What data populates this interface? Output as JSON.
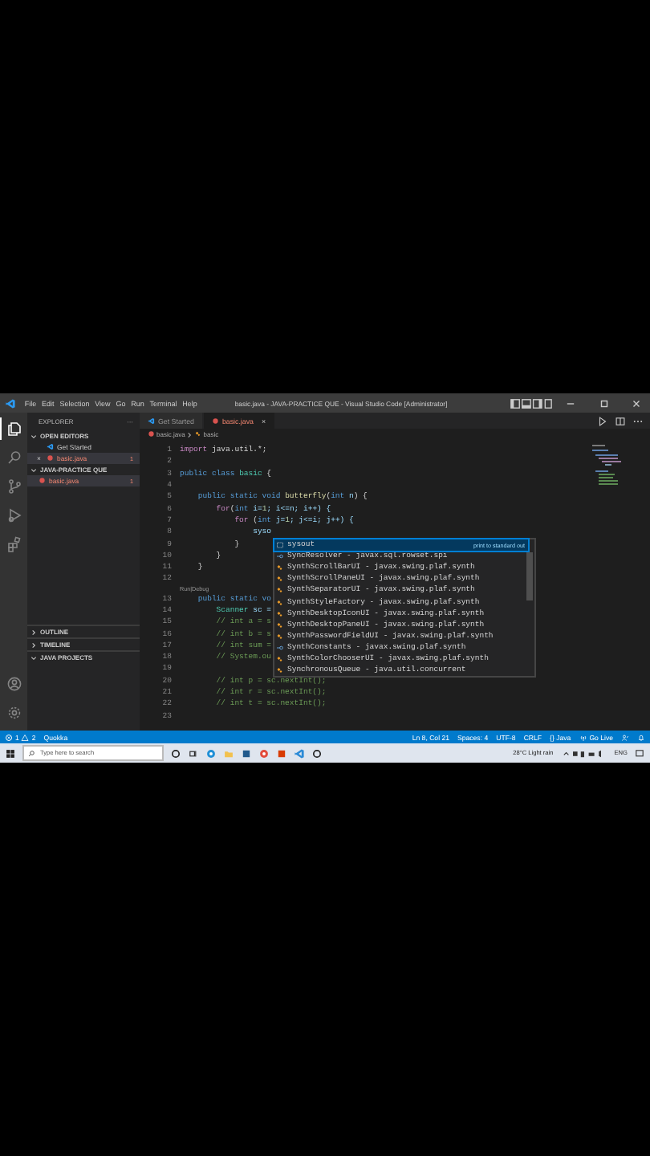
{
  "title_bar": {
    "menu": [
      "File",
      "Edit",
      "Selection",
      "View",
      "Go",
      "Run",
      "Terminal",
      "Help"
    ],
    "title": "basic.java - JAVA-PRACTICE QUE - Visual Studio Code [Administrator]"
  },
  "activity_bar": {
    "top": [
      {
        "kind": "files",
        "selected": true
      },
      {
        "kind": "search",
        "selected": false
      },
      {
        "kind": "source-control",
        "selected": false
      },
      {
        "kind": "run-debug",
        "selected": false
      },
      {
        "kind": "extensions",
        "selected": false
      }
    ],
    "bottom": [
      {
        "kind": "account"
      },
      {
        "kind": "settings"
      }
    ]
  },
  "sidebar": {
    "title": "EXPLORER",
    "more": "···",
    "sections": [
      {
        "label": "OPEN EDITORS",
        "expanded": true,
        "items": [
          {
            "label": "Get Started",
            "kind": "welcome",
            "error": false,
            "selected": false
          },
          {
            "label": "basic.java",
            "kind": "java",
            "error": true,
            "badge": "1",
            "close": "×",
            "selected": true
          }
        ]
      },
      {
        "label": "JAVA-PRACTICE QUE",
        "expanded": true,
        "items": [
          {
            "label": "basic.java",
            "kind": "java",
            "error": true,
            "badge": "1",
            "selected": true
          }
        ]
      }
    ],
    "panels": [
      {
        "label": "OUTLINE",
        "expanded": false
      },
      {
        "label": "TIMELINE",
        "expanded": false
      },
      {
        "label": "JAVA PROJECTS",
        "expanded": true
      }
    ]
  },
  "editor": {
    "tabs": [
      {
        "label": "Get Started",
        "kind": "welcome",
        "error": false,
        "selected": false
      },
      {
        "label": "basic.java",
        "kind": "java",
        "error": true,
        "close": "×",
        "selected": true
      }
    ],
    "breadcrumb": [
      {
        "label": "basic.java",
        "kind": "java"
      },
      {
        "label": "basic",
        "kind": "class"
      }
    ],
    "lines": [
      {
        "kind": "code",
        "number": "1",
        "tokens": [
          {
            "text": "import ",
            "kind": "ctl"
          },
          {
            "text": "java.util.*;",
            "kind": "txt"
          }
        ]
      },
      {
        "kind": "code",
        "number": "2"
      },
      {
        "kind": "code",
        "number": "3",
        "tokens": [
          {
            "text": "public class ",
            "kind": "kw"
          },
          {
            "text": "basic",
            "kind": "type"
          },
          {
            "text": " {",
            "kind": "txt"
          }
        ]
      },
      {
        "kind": "code",
        "number": "4"
      },
      {
        "kind": "code",
        "number": "5",
        "tokens": [
          {
            "text": "    public static void ",
            "kind": "kw"
          },
          {
            "text": "butterfly",
            "kind": "fn"
          },
          {
            "text": "(",
            "kind": "txt"
          },
          {
            "text": "int",
            "kind": "kw"
          },
          {
            "text": " n",
            "kind": "var"
          },
          {
            "text": ") {",
            "kind": "txt"
          }
        ]
      },
      {
        "kind": "code",
        "number": "6",
        "tokens": [
          {
            "text": "        for",
            "kind": "ctl"
          },
          {
            "text": "(",
            "kind": "txt"
          },
          {
            "text": "int",
            "kind": "kw"
          },
          {
            "text": " i=",
            "kind": "var"
          },
          {
            "text": "1",
            "kind": "num"
          },
          {
            "text": "; i<=n; i++) {",
            "kind": "var"
          }
        ]
      },
      {
        "kind": "code",
        "number": "7",
        "tokens": [
          {
            "text": "            for",
            "kind": "ctl"
          },
          {
            "text": " (",
            "kind": "txt"
          },
          {
            "text": "int",
            "kind": "kw"
          },
          {
            "text": " j=",
            "kind": "var"
          },
          {
            "text": "1",
            "kind": "num"
          },
          {
            "text": "; j<=i; j++) {",
            "kind": "var"
          }
        ]
      },
      {
        "kind": "code",
        "number": "8",
        "tokens": [
          {
            "text": "                syso",
            "kind": "var"
          }
        ]
      },
      {
        "kind": "code",
        "number": "9",
        "tokens": [
          {
            "text": "            }",
            "kind": "txt"
          }
        ]
      },
      {
        "kind": "code",
        "number": "10",
        "tokens": [
          {
            "text": "        }",
            "kind": "txt"
          }
        ]
      },
      {
        "kind": "code",
        "number": "11",
        "tokens": [
          {
            "text": "    }",
            "kind": "txt"
          }
        ]
      },
      {
        "kind": "code",
        "number": "12"
      },
      {
        "kind": "codelens",
        "text": "Run|Debug"
      },
      {
        "kind": "code",
        "number": "13",
        "tokens": [
          {
            "text": "    public static vo",
            "kind": "kw"
          }
        ]
      },
      {
        "kind": "code",
        "number": "14",
        "tokens": [
          {
            "text": "        Scanner",
            "kind": "type"
          },
          {
            "text": " sc =",
            "kind": "var"
          }
        ]
      },
      {
        "kind": "code",
        "number": "15",
        "tokens": [
          {
            "text": "        // int a = s",
            "kind": "com"
          }
        ]
      },
      {
        "kind": "code",
        "number": "16",
        "tokens": [
          {
            "text": "        // int b = s",
            "kind": "com"
          }
        ]
      },
      {
        "kind": "code",
        "number": "17",
        "tokens": [
          {
            "text": "        // int sum =",
            "kind": "com"
          }
        ]
      },
      {
        "kind": "code",
        "number": "18",
        "tokens": [
          {
            "text": "        // System.ou",
            "kind": "com"
          }
        ]
      },
      {
        "kind": "code",
        "number": "19"
      },
      {
        "kind": "code",
        "number": "20",
        "tokens": [
          {
            "text": "        // int p = sc.nextInt();",
            "kind": "com"
          }
        ]
      },
      {
        "kind": "code",
        "number": "21",
        "tokens": [
          {
            "text": "        // int r = sc.nextInt();",
            "kind": "com"
          }
        ]
      },
      {
        "kind": "code",
        "number": "22",
        "tokens": [
          {
            "text": "        // int t = sc.nextInt();",
            "kind": "com"
          }
        ]
      },
      {
        "kind": "code",
        "number": "23"
      }
    ],
    "suggestions": [
      {
        "kind": "snippet",
        "name": "sysout",
        "detail": "print to standard out",
        "selected": true
      },
      {
        "kind": "interface",
        "name": "SyncResolver - javax.sql.rowset.spi",
        "selected": false
      },
      {
        "kind": "class",
        "name": "SynthScrollBarUI - javax.swing.plaf.synth",
        "selected": false
      },
      {
        "kind": "class",
        "name": "SynthScrollPaneUI - javax.swing.plaf.synth",
        "selected": false
      },
      {
        "kind": "class",
        "name": "SynthSeparatorUI - javax.swing.plaf.synth",
        "selected": false
      },
      {
        "kind": "class",
        "name": "SynthStyleFactory - javax.swing.plaf.synth",
        "selected": false
      },
      {
        "kind": "class",
        "name": "SynthDesktopIconUI - javax.swing.plaf.synth",
        "selected": false
      },
      {
        "kind": "class",
        "name": "SynthDesktopPaneUI - javax.swing.plaf.synth",
        "selected": false
      },
      {
        "kind": "class",
        "name": "SynthPasswordFieldUI - javax.swing.plaf.synth",
        "selected": false
      },
      {
        "kind": "interface",
        "name": "SynthConstants - javax.swing.plaf.synth",
        "selected": false
      },
      {
        "kind": "class",
        "name": "SynthColorChooserUI - javax.swing.plaf.synth",
        "selected": false
      },
      {
        "kind": "class",
        "name": "SynchronousQueue - java.util.concurrent",
        "selected": false
      }
    ]
  },
  "status_bar": {
    "errors": "1",
    "warnings": "2",
    "left": [
      "Quokka"
    ],
    "right": [
      {
        "text": "Ln 8, Col 21"
      },
      {
        "text": "Spaces: 4"
      },
      {
        "text": "UTF-8"
      },
      {
        "text": "CRLF"
      },
      {
        "text": "{} Java"
      },
      {
        "text": "Go Live",
        "kind": "broadcast"
      }
    ]
  },
  "taskbar": {
    "search": {
      "placeholder": "Type here to search"
    },
    "apps": [
      {
        "kind": "cortana"
      },
      {
        "kind": "task-view"
      },
      {
        "kind": "browser",
        "color": "#1f8fd6"
      },
      {
        "kind": "folder",
        "color": "#f2c14e"
      },
      {
        "kind": "store",
        "color": "#225a8c"
      },
      {
        "kind": "browser",
        "color": "#e24b3b"
      },
      {
        "kind": "store",
        "color": "#d83b01"
      },
      {
        "kind": "code",
        "color": "#2b8ad6"
      },
      {
        "kind": "cortana",
        "color": "#222222"
      }
    ],
    "weather": "28°C  Light rain",
    "language": "ENG"
  }
}
